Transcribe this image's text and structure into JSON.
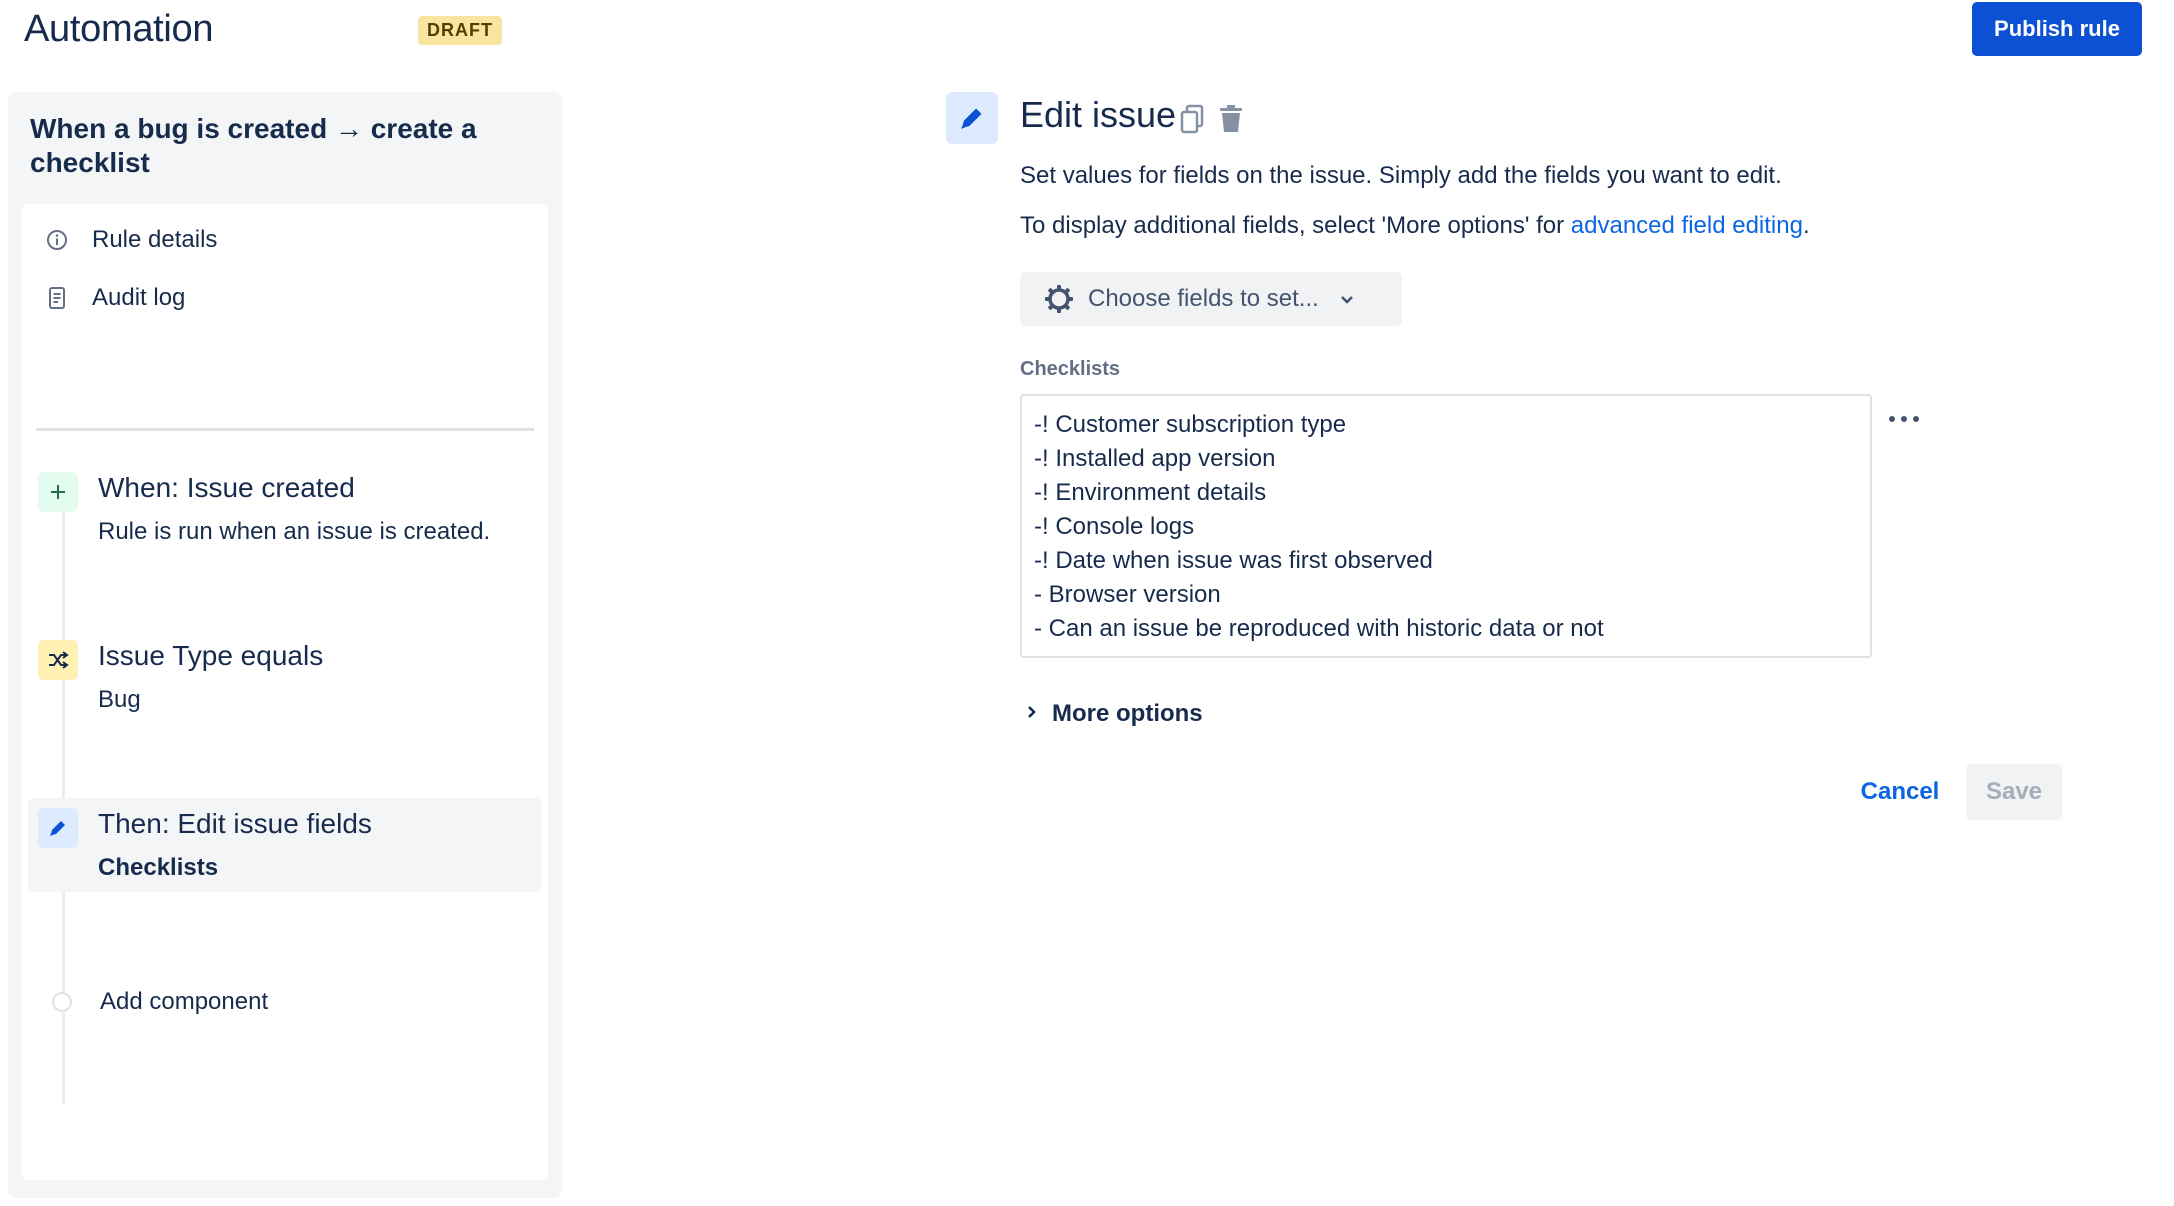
{
  "header": {
    "app_title": "Automation",
    "status_badge": "DRAFT",
    "publish_label": "Publish rule"
  },
  "sidebar": {
    "rule_name": "When a bug is created → create a checklist",
    "nav": [
      {
        "label": "Rule details",
        "icon": "info-icon"
      },
      {
        "label": "Audit log",
        "icon": "document-icon"
      }
    ],
    "steps": [
      {
        "title": "When: Issue created",
        "subtitle": "Rule is run when an issue is created.",
        "icon": "plus-icon",
        "color": "#e3fcef"
      },
      {
        "title": "Issue Type equals",
        "subtitle": "Bug",
        "icon": "shuffle-icon",
        "color": "#fff0b3"
      },
      {
        "title": "Then: Edit issue fields",
        "subtitle": "Checklists",
        "icon": "pencil-icon",
        "color": "#deebff",
        "active": true
      }
    ],
    "add_component_label": "Add component"
  },
  "main": {
    "title": "Edit issue",
    "description": "Set values for fields on the issue. Simply add the fields you want to edit.",
    "hint_prefix": "To display additional fields, select 'More options' for ",
    "hint_link": "advanced field editing",
    "hint_suffix": ".",
    "choose_fields_label": "Choose fields to set...",
    "field_label": "Checklists",
    "checklist_lines": [
      "-! Customer subscription type",
      "-! Installed app version",
      "-! Environment details",
      "-! Console logs",
      "-! Date when issue was first observed",
      "- Browser version",
      "- Can an issue be reproduced with historic data or not"
    ],
    "more_options_label": "More options",
    "cancel_label": "Cancel",
    "save_label": "Save"
  },
  "colors": {
    "primary": "#0c51d4",
    "link": "#0c66e4",
    "text": "#172b4d",
    "draft_bg": "#f8e6a0"
  }
}
